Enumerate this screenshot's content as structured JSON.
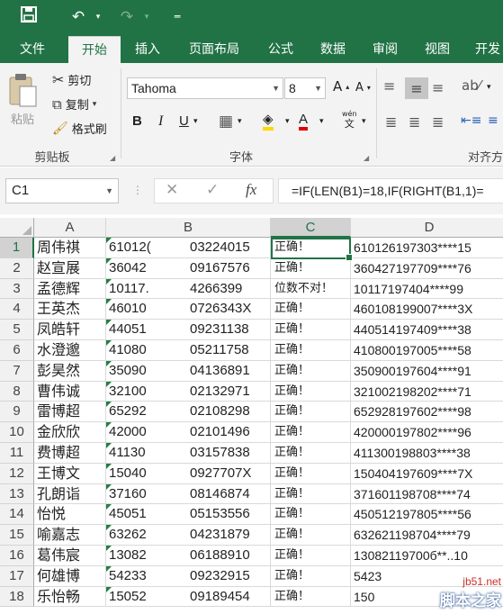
{
  "quick_access": {
    "save_icon": "save-icon",
    "undo_icon": "undo-icon",
    "redo_icon": "redo-icon",
    "customize_icon": "customize-icon"
  },
  "tabs": [
    "文件",
    "开始",
    "插入",
    "页面布局",
    "公式",
    "数据",
    "审阅",
    "视图",
    "开发"
  ],
  "active_tab": "开始",
  "ribbon": {
    "clipboard": {
      "paste": "粘贴",
      "cut": "剪切",
      "copy": "复制",
      "format_painter": "格式刷",
      "group_label": "剪贴板"
    },
    "font": {
      "font_name": "Tahoma",
      "font_size": "8",
      "group_label": "字体",
      "bold": "B",
      "italic": "I",
      "underline": "U"
    },
    "alignment": {
      "group_label": "对齐方"
    }
  },
  "formula_bar": {
    "name_box": "C1",
    "formula": "=IF(LEN(B1)=18,IF(RIGHT(B1,1)=",
    "fx_label": "fx"
  },
  "grid": {
    "columns": [
      "A",
      "B",
      "C",
      "D"
    ],
    "selected_column": "C",
    "selected_row": "1",
    "rows": [
      {
        "n": "1",
        "a": "周伟祺",
        "b1": "61012(",
        "b2": "03224015",
        "c": "正确！",
        "d": "610126197303****15"
      },
      {
        "n": "2",
        "a": "赵宣展",
        "b1": "36042",
        "b2": "09167576",
        "c": "正确！",
        "d": "360427197709****76"
      },
      {
        "n": "3",
        "a": "孟德辉",
        "b1": "10117.",
        "b2": "4266399",
        "c": "位数不对！",
        "d": "10117197404****99"
      },
      {
        "n": "4",
        "a": "王英杰",
        "b1": "46010",
        "b2": "0726343X",
        "c": "正确！",
        "d": "460108199007****3X"
      },
      {
        "n": "5",
        "a": "凤皓轩",
        "b1": "44051",
        "b2": "09231138",
        "c": "正确！",
        "d": "440514197409****38"
      },
      {
        "n": "6",
        "a": "水澄邈",
        "b1": "41080",
        "b2": "05211758",
        "c": "正确！",
        "d": "410800197005****58"
      },
      {
        "n": "7",
        "a": "彭昊然",
        "b1": "35090",
        "b2": "04136891",
        "c": "正确！",
        "d": "350900197604****91"
      },
      {
        "n": "8",
        "a": "曹伟诚",
        "b1": "32100",
        "b2": "02132971",
        "c": "正确！",
        "d": "321002198202****71"
      },
      {
        "n": "9",
        "a": "雷博超",
        "b1": "65292",
        "b2": "02108298",
        "c": "正确！",
        "d": "652928197602****98"
      },
      {
        "n": "10",
        "a": "金欣欣",
        "b1": "42000",
        "b2": "02101496",
        "c": "正确！",
        "d": "420000197802****96"
      },
      {
        "n": "11",
        "a": "费博超",
        "b1": "41130",
        "b2": "03157838",
        "c": "正确！",
        "d": "411300198803****38"
      },
      {
        "n": "12",
        "a": "王博文",
        "b1": "15040",
        "b2": "0927707X",
        "c": "正确！",
        "d": "150404197609****7X"
      },
      {
        "n": "13",
        "a": "孔朗诣",
        "b1": "37160",
        "b2": "08146874",
        "c": "正确！",
        "d": "371601198708****74"
      },
      {
        "n": "14",
        "a": "怡悦",
        "b1": "45051",
        "b2": "05153556",
        "c": "正确！",
        "d": "450512197805****56"
      },
      {
        "n": "15",
        "a": "喻嘉志",
        "b1": "63262",
        "b2": "04231879",
        "c": "正确！",
        "d": "632621198704****79"
      },
      {
        "n": "16",
        "a": "葛伟宸",
        "b1": "13082",
        "b2": "06188910",
        "c": "正确！",
        "d": "13082119700б**..10"
      },
      {
        "n": "17",
        "a": "何雄博",
        "b1": "54233",
        "b2": "09232915",
        "c": "正确！",
        "d": "5423"
      },
      {
        "n": "18",
        "a": "乐怡畅",
        "b1": "15052",
        "b2": "09189454",
        "c": "正确！",
        "d": "150"
      }
    ]
  },
  "watermark": {
    "line1": "jb51.net",
    "line2": "脚本之家"
  },
  "colors": {
    "accent": "#217346",
    "ribbon_bg": "#f3f3f3",
    "error_triangle": "#208040"
  }
}
